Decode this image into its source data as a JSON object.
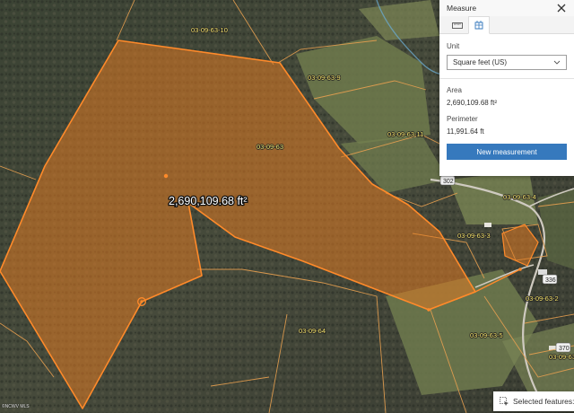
{
  "map": {
    "area_label": "2,690,109.68 ft²",
    "parcels": {
      "p1": "03-09-63-10",
      "p2": "03-09-63-9",
      "p3": "03-09-63-11",
      "p4": "03-09-63",
      "p5": "03-09-63-4",
      "p6": "03-09-63-3",
      "p7": "03-09-63-2",
      "p8": "03-09-64",
      "p9": "03-09-63-5",
      "p10": "03-09-63-8"
    },
    "roads": {
      "r1": "302",
      "r2": "336",
      "r3": "370"
    },
    "attribution": "©NCWV MLS",
    "colors": {
      "polygon_fill": "#e07a22",
      "polygon_stroke": "#ff8a2a",
      "parcel_line": "#e8a050"
    }
  },
  "measure_panel": {
    "title": "Measure",
    "unit_label": "Unit",
    "unit_value": "Square feet (US)",
    "area_label": "Area",
    "area_value": "2,690,109.68 ft²",
    "perimeter_label": "Perimeter",
    "perimeter_value": "11,991.64 ft",
    "button_label": "New measurement",
    "accent": "#3679bd"
  },
  "selected_features": {
    "label": "Selected features:"
  }
}
